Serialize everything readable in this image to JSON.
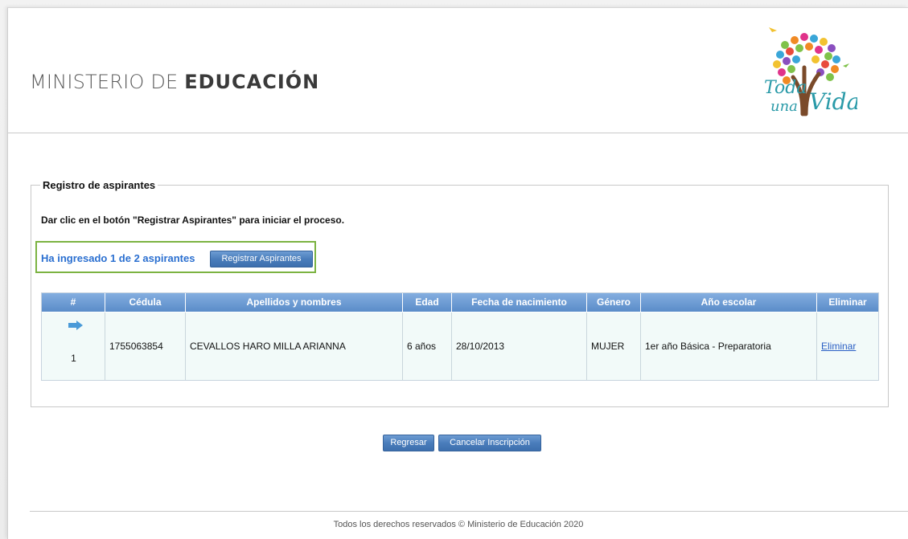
{
  "header": {
    "brand_prefix": "MINISTERIO DE ",
    "brand_bold": "EDUCACIÓN",
    "logo_alt": "Toda una Vida"
  },
  "panel": {
    "legend": "Registro de aspirantes",
    "instructions": "Dar clic en el botón \"Registrar Aspirantes\" para iniciar el proceso.",
    "count_text": "Ha ingresado 1 de 2 aspirantes",
    "register_button": "Registrar Aspirantes"
  },
  "table": {
    "headers": [
      "#",
      "Cédula",
      "Apellidos y nombres",
      "Edad",
      "Fecha de nacimiento",
      "Género",
      "Año escolar",
      "Eliminar"
    ],
    "rows": [
      {
        "num": "1",
        "icon": "arrow-right-icon",
        "cedula": "1755063854",
        "nombre": "CEVALLOS HARO MILLA ARIANNA",
        "edad": "6 años",
        "fecha": "28/10/2013",
        "genero": "MUJER",
        "anio": "1er año Básica - Preparatoria",
        "eliminar": "Eliminar"
      }
    ]
  },
  "actions": {
    "back": "Regresar",
    "cancel": "Cancelar Inscripción"
  },
  "footer": {
    "text": "Todos los derechos reservados © Ministerio de Educación 2020"
  },
  "colors": {
    "accent": "#4a7dbb",
    "highlight_border": "#7cb342",
    "count_text": "#2a6fd0"
  }
}
